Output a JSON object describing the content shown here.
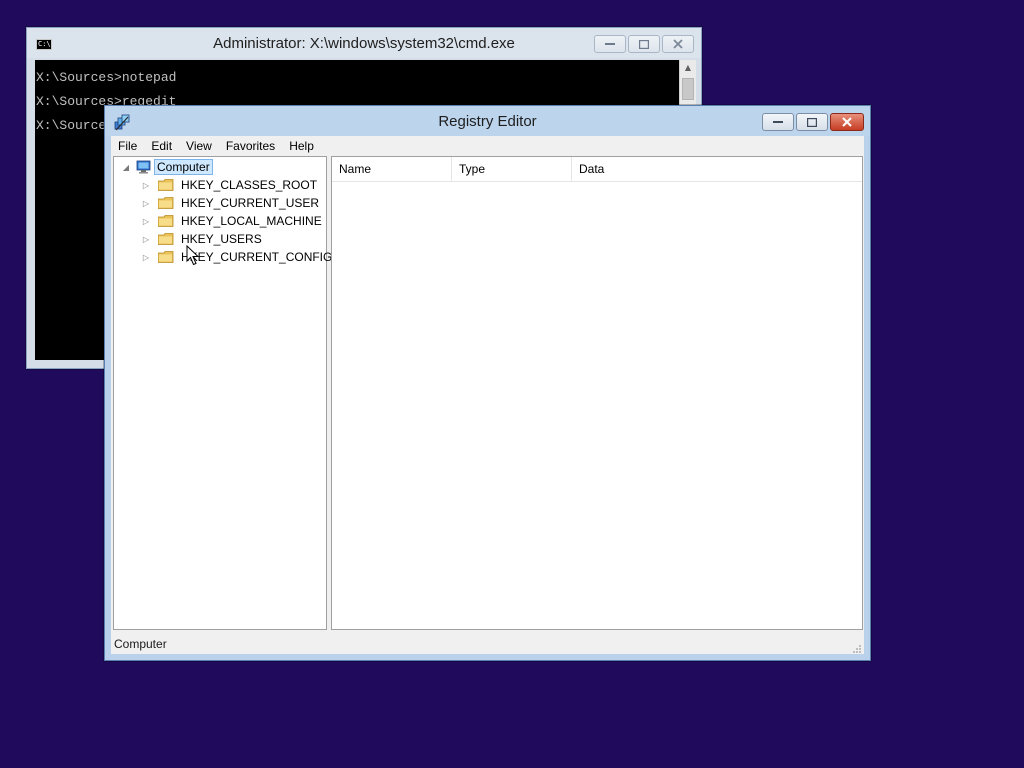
{
  "cmd_window": {
    "title": "Administrator: X:\\windows\\system32\\cmd.exe",
    "icon_text": "C:\\",
    "lines": [
      "X:\\Sources>notepad",
      "X:\\Sources>regedit",
      "X:\\Sources"
    ]
  },
  "regedit_window": {
    "title": "Registry Editor",
    "menu": [
      "File",
      "Edit",
      "View",
      "Favorites",
      "Help"
    ],
    "tree": {
      "root": "Computer",
      "hives": [
        "HKEY_CLASSES_ROOT",
        "HKEY_CURRENT_USER",
        "HKEY_LOCAL_MACHINE",
        "HKEY_USERS",
        "HKEY_CURRENT_CONFIG"
      ]
    },
    "columns": [
      "Name",
      "Type",
      "Data"
    ],
    "status": "Computer"
  },
  "colors": {
    "desktop": "#1f0a5c",
    "selection": "#cde8ff",
    "close_button": "#c63d24"
  }
}
